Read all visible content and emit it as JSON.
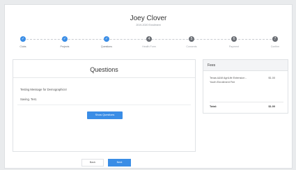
{
  "header": {
    "name": "Joey Clover",
    "subtitle": "2019-2020 Enrollment"
  },
  "steps": [
    {
      "label": "Clubs",
      "number": "",
      "state": "done"
    },
    {
      "label": "Projects",
      "number": "",
      "state": "done"
    },
    {
      "label": "Questions",
      "number": "",
      "state": "done"
    },
    {
      "label": "Health Form",
      "number": "4",
      "state": "todo"
    },
    {
      "label": "Consents",
      "number": "5",
      "state": "todo"
    },
    {
      "label": "Payment",
      "number": "6",
      "state": "todo"
    },
    {
      "label": "Confirm",
      "number": "7",
      "state": "todo"
    }
  ],
  "questions": {
    "title": "Questions",
    "message": "Testing Message for Demographics!",
    "message2": "Saving. Test.",
    "show_button": "Show Questions"
  },
  "fees": {
    "title": "Fees",
    "item_name": "Texas A&M AgriLife Extension - Youth Enrollment Fee",
    "item_amount": "$1.00",
    "total_label": "Total:",
    "total_amount": "$1.00"
  },
  "nav": {
    "back": "Back",
    "next": "Next"
  },
  "colors": {
    "accent": "#3a8de6",
    "step_todo": "#6a6e74"
  }
}
